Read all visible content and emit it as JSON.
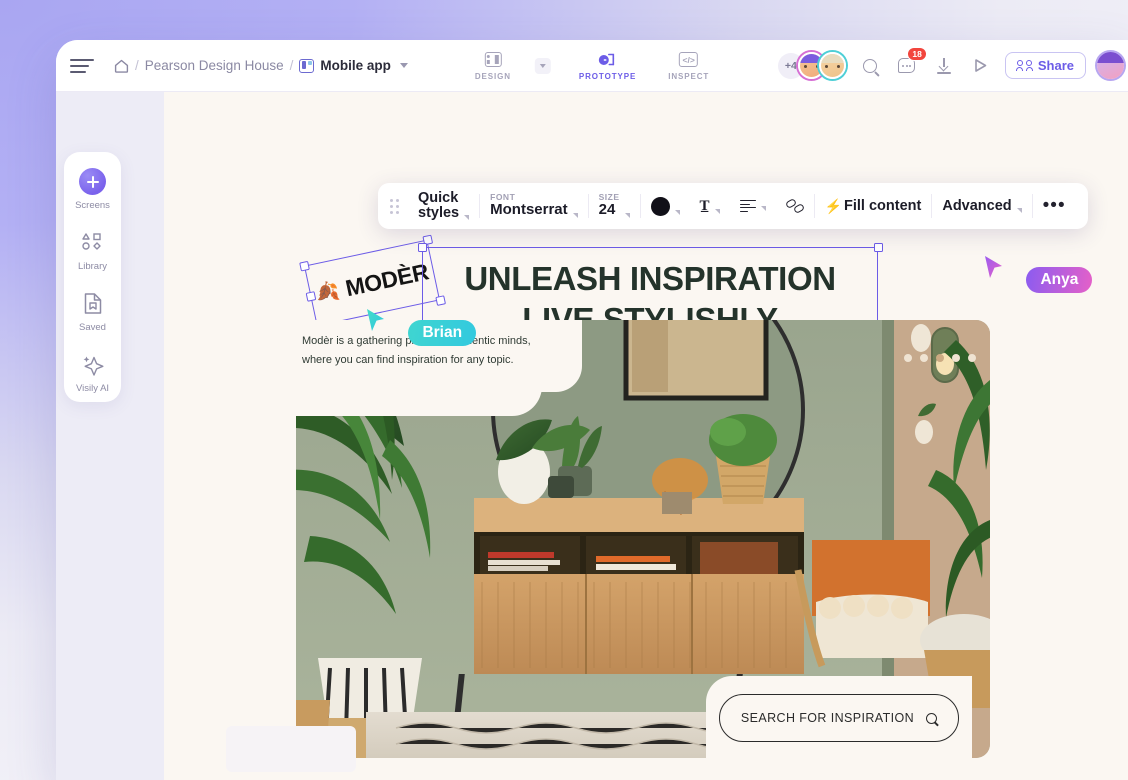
{
  "window": {
    "header": {
      "menu_icon": "hamburger-menu-icon",
      "breadcrumb": {
        "home_icon": "home-icon",
        "separator": "/",
        "project": "Pearson Design House",
        "file_icon": "file-thumbnail-icon",
        "file": "Mobile app",
        "dropdown_icon": "chevron-down-icon"
      },
      "tabs": [
        {
          "label": "DESIGN",
          "icon": "design-panel-icon",
          "active": false,
          "has_dropdown": true
        },
        {
          "label": "PROTOTYPE",
          "icon": "prototype-flow-icon",
          "active": true,
          "has_dropdown": false
        },
        {
          "label": "INSPECT",
          "icon": "code-inspect-icon",
          "active": false,
          "has_dropdown": false
        }
      ],
      "collaborators": {
        "overflow_count": "+4",
        "avatars": [
          "avatar-collaborator-1",
          "avatar-collaborator-2"
        ],
        "edge_avatar": "avatar-current-user"
      },
      "actions": {
        "search_icon": "search-icon",
        "comments_icon": "comment-bubble-icon",
        "comments_badge": "18",
        "download_icon": "download-icon",
        "present_icon": "play-present-icon",
        "share_label": "Share",
        "share_icon": "people-share-icon"
      }
    },
    "sidebar": {
      "items": [
        {
          "label": "Screens",
          "icon": "plus-circle-icon",
          "active": true
        },
        {
          "label": "Library",
          "icon": "shapes-library-icon",
          "active": false
        },
        {
          "label": "Saved",
          "icon": "saved-document-icon",
          "active": false
        },
        {
          "label": "Visily AI",
          "icon": "ai-sparkle-icon",
          "active": false
        }
      ]
    },
    "property_toolbar": {
      "drag_handle_icon": "drag-handle-icon",
      "quick_styles_line1": "Quick",
      "quick_styles_line2": "styles",
      "font_label": "FONT",
      "font_value": "Montserrat",
      "size_label": "SIZE",
      "size_value": "24",
      "color_swatch": "#111018",
      "color_icon": "color-swatch-icon",
      "text_format_icon": "text-format-icon",
      "align_icon": "text-align-icon",
      "link_icon": "link-icon",
      "fill_content_label": "Fill content",
      "fill_content_icon": "lightning-bolt-icon",
      "advanced_label": "Advanced",
      "more_label": "•••",
      "more_icon": "more-options-icon"
    },
    "canvas": {
      "logo": {
        "mark_icon": "leaf-logo-icon",
        "text": "MODÈR"
      },
      "headline": {
        "line1": "UNLEASH INSPIRATION",
        "line2": "LIVE STYLISHLY",
        "color": "#24332b"
      },
      "description": "Modèr is a gathering place for authentic minds, where you can find inspiration for any topic.",
      "search_button": {
        "label": "SEARCH FOR INSPIRATION",
        "icon": "search-icon"
      },
      "cursors": [
        {
          "name": "Brian",
          "color": "#3fd5d0"
        },
        {
          "name": "Anya",
          "color": "#8b5cf0"
        }
      ]
    }
  }
}
